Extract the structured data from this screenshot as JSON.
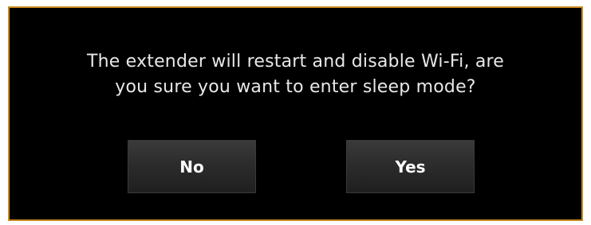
{
  "dialog": {
    "message_line1": "The extender will restart and disable Wi-Fi, are",
    "message_line2": "you sure you want to enter sleep mode?",
    "no_label": "No",
    "yes_label": "Yes"
  },
  "colors": {
    "background": "#000000",
    "border": "#c98a1e",
    "text": "#e8e8e8",
    "button": "#2c2c2c"
  }
}
